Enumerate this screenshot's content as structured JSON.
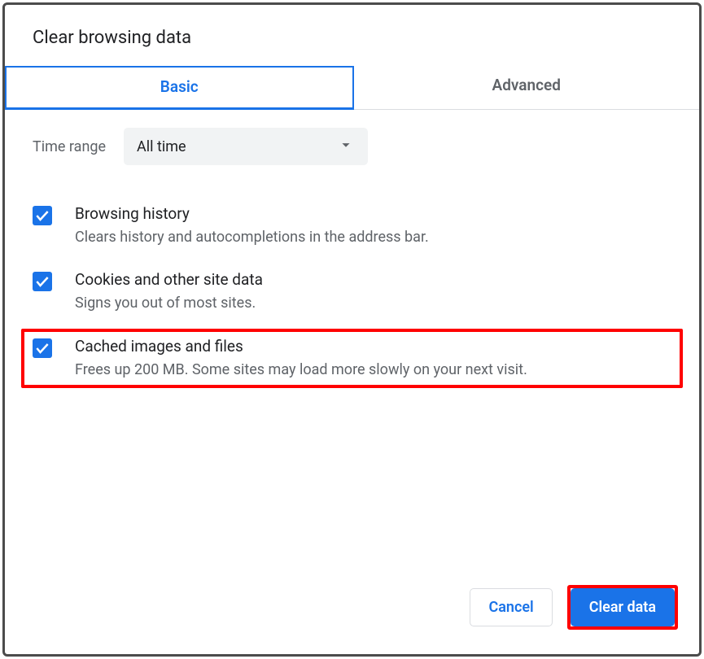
{
  "dialog": {
    "title": "Clear browsing data"
  },
  "tabs": {
    "basic": "Basic",
    "advanced": "Advanced",
    "active": "basic"
  },
  "time_range": {
    "label": "Time range",
    "selected": "All time"
  },
  "options": [
    {
      "checked": true,
      "title": "Browsing history",
      "desc": "Clears history and autocompletions in the address bar.",
      "highlighted": false
    },
    {
      "checked": true,
      "title": "Cookies and other site data",
      "desc": "Signs you out of most sites.",
      "highlighted": false
    },
    {
      "checked": true,
      "title": "Cached images and files",
      "desc": "Frees up 200 MB. Some sites may load more slowly on your next visit.",
      "highlighted": true
    }
  ],
  "footer": {
    "cancel": "Cancel",
    "clear": "Clear data"
  },
  "colors": {
    "accent": "#1a73e8",
    "highlight": "#ff0000",
    "text_primary": "#202124",
    "text_secondary": "#5f6368"
  }
}
